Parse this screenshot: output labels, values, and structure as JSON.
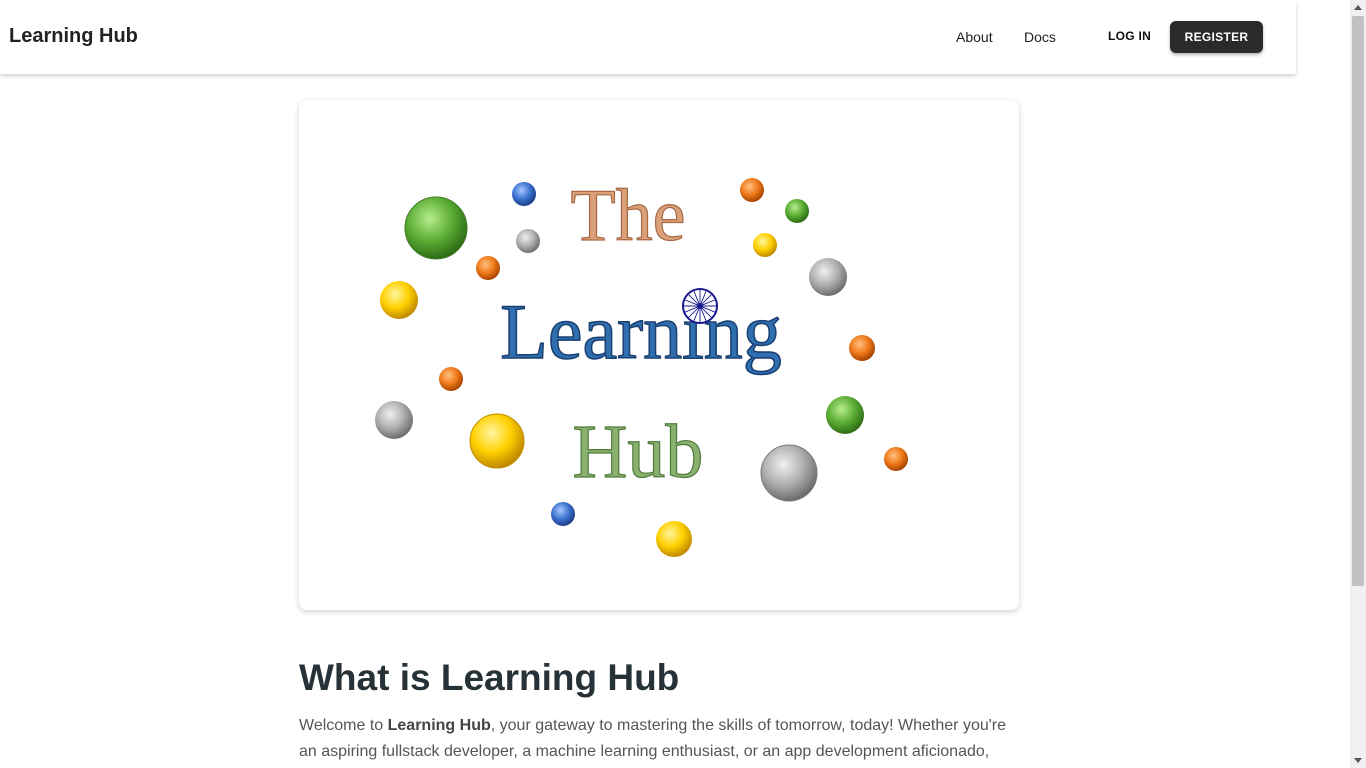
{
  "header": {
    "brand": "Learning Hub",
    "nav": [
      "About",
      "Docs"
    ],
    "login_label": "LOG IN",
    "register_label": "REGISTER"
  },
  "hero_logo": {
    "line1": "The",
    "line2": "Learning",
    "line3": "Hub",
    "colors": {
      "the": "#d9a07a",
      "learning": "#2f6fb0",
      "hub": "#8ab070"
    }
  },
  "section": {
    "title": "What is Learning Hub",
    "intro_pre": "Welcome to ",
    "intro_bold": "Learning Hub",
    "intro_post": ", your gateway to mastering the skills of tomorrow, today! Whether you're an aspiring fullstack developer, a machine learning enthusiast, or an app development aficionado,"
  },
  "icons": [
    "ashoka-chakra-icon",
    "scroll-up-icon",
    "scroll-down-icon"
  ]
}
